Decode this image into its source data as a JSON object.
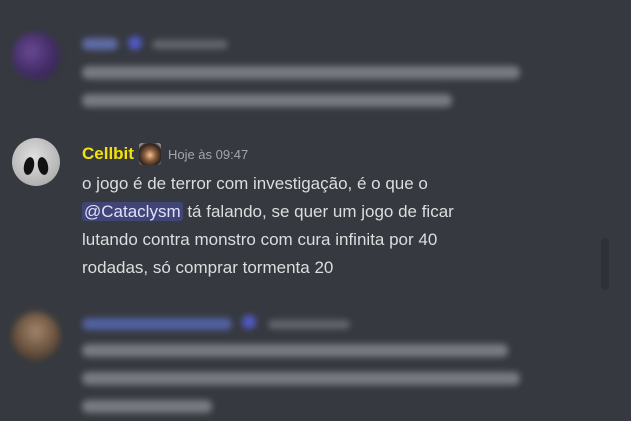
{
  "main_message": {
    "username": "Cellbit",
    "timestamp": "Hoje às 09:47",
    "line1": "o jogo é de terror com investigação, é o que o",
    "mention": "@Cataclysm",
    "line2_rest": " tá falando, se quer um jogo de ficar",
    "line3": "lutando contra monstro com cura infinita por 40",
    "line4": "rodadas, só comprar tormenta 20"
  },
  "colors": {
    "background": "#36393f",
    "username": "#f4e00b",
    "text": "#dcddde",
    "timestamp": "#a3a6aa",
    "mention_bg": "rgba(88,101,242,0.3)",
    "mention_text": "#dee0fc"
  },
  "icons": {
    "role_icon": "user-badge-icon",
    "verified_icon": "verified-badge-icon"
  }
}
